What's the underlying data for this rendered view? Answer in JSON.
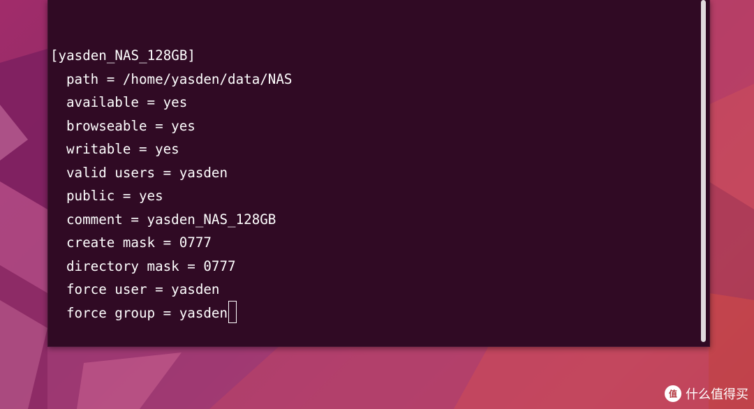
{
  "colors": {
    "terminal_bg": "#300a24",
    "terminal_fg": "#ffffff",
    "wallpaper_primary": "#a12c6a",
    "wallpaper_secondary": "#c94a58"
  },
  "terminal": {
    "section_header": "[yasden_NAS_128GB]",
    "config_lines": [
      "path = /home/yasden/data/NAS",
      "available = yes",
      "browseable = yes",
      "writable = yes",
      "valid users = yasden",
      "public = yes",
      "comment = yasden_NAS_128GB",
      "create mask = 0777",
      "directory mask = 0777",
      "force user = yasden",
      "force group = yasden"
    ]
  },
  "watermark": {
    "icon": "smzdm-logo-icon",
    "text": "什么值得买"
  }
}
